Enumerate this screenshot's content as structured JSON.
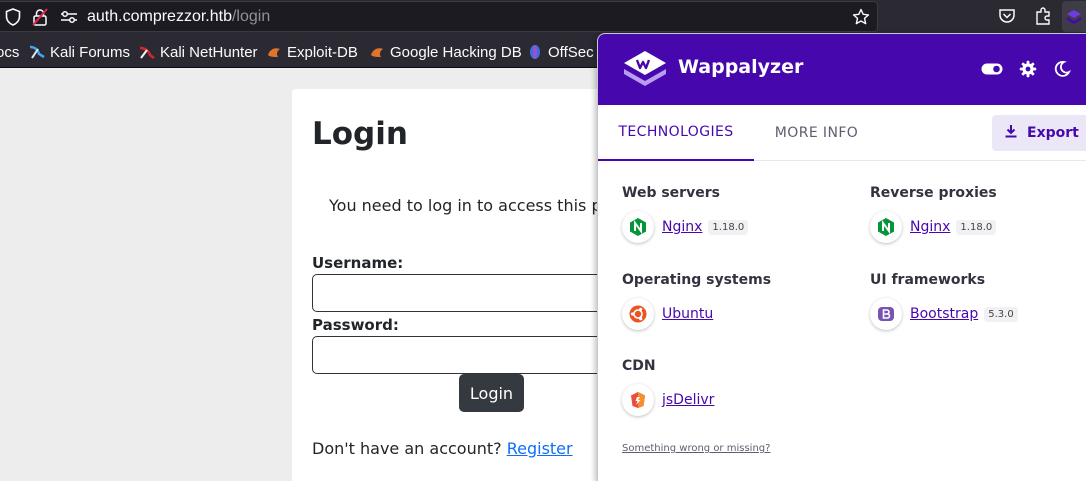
{
  "browser": {
    "url_host": "auth.comprezzor.htb",
    "url_path": "/login",
    "bookmarks": [
      {
        "label": "ocs",
        "icon": "none"
      },
      {
        "label": "Kali Forums",
        "icon": "kali-forums-icon"
      },
      {
        "label": "Kali NetHunter",
        "icon": "kali-nethunter-icon"
      },
      {
        "label": "Exploit-DB",
        "icon": "exploit-db-icon"
      },
      {
        "label": "Google Hacking DB",
        "icon": "ghdb-icon"
      },
      {
        "label": "OffSec",
        "icon": "offsec-icon"
      }
    ]
  },
  "page": {
    "title": "Login",
    "message": "You need to log in to access this page.",
    "username_label": "Username:",
    "password_label": "Password:",
    "login_button": "Login",
    "register_prompt": "Don't have an account?",
    "register_link": "Register"
  },
  "wappalyzer": {
    "title": "Wappalyzer",
    "tabs": {
      "technologies": "TECHNOLOGIES",
      "more_info": "MORE INFO"
    },
    "export_label": "Export",
    "categories": [
      {
        "title": "Web servers",
        "techs": [
          {
            "name": "Nginx",
            "version": "1.18.0",
            "icon": "nginx-icon"
          }
        ]
      },
      {
        "title": "Reverse proxies",
        "techs": [
          {
            "name": "Nginx",
            "version": "1.18.0",
            "icon": "nginx-icon"
          }
        ]
      },
      {
        "title": "Operating systems",
        "techs": [
          {
            "name": "Ubuntu",
            "version": "",
            "icon": "ubuntu-icon"
          }
        ]
      },
      {
        "title": "UI frameworks",
        "techs": [
          {
            "name": "Bootstrap",
            "version": "5.3.0",
            "icon": "bootstrap-icon"
          }
        ]
      },
      {
        "title": "CDN",
        "techs": [
          {
            "name": "jsDelivr",
            "version": "",
            "icon": "jsdelivr-icon"
          }
        ]
      }
    ],
    "footer_link": "Something wrong or missing?"
  },
  "colors": {
    "wappalyzer_purple": "#4608ad",
    "link_blue": "#0d6efd",
    "login_button": "#343a40",
    "chrome_dark": "#2b2a33"
  }
}
